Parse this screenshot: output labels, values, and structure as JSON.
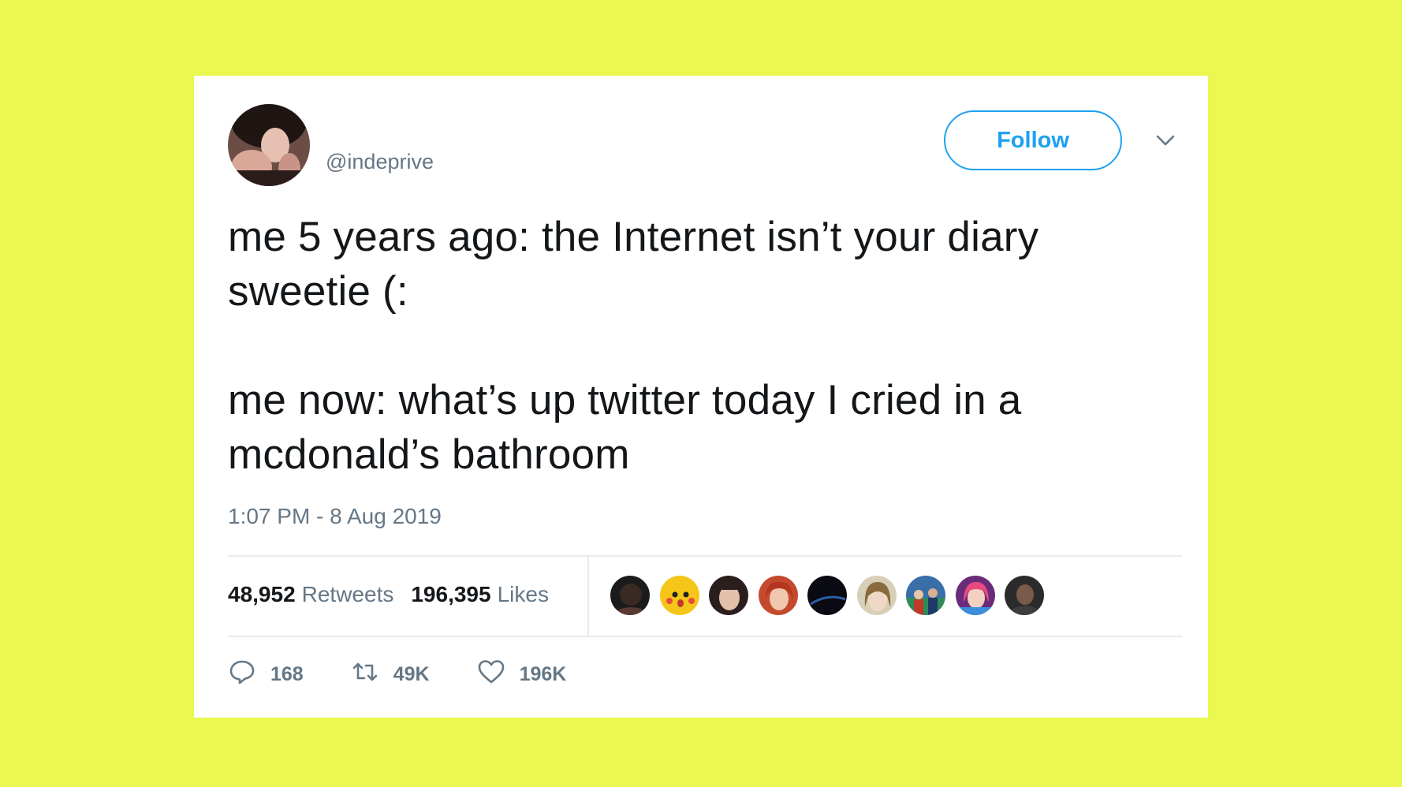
{
  "tweet": {
    "handle": "@indeprive",
    "follow_label": "Follow",
    "text_lines": [
      "me 5 years ago: the Internet isn’t your diary",
      "sweetie (:",
      "",
      "me now: what’s up twitter today I cried in a",
      "mcdonald’s bathroom"
    ],
    "timestamp": "1:07 PM - 8 Aug 2019"
  },
  "stats": {
    "retweets_count": "48,952",
    "retweets_label": "Retweets",
    "likes_count": "196,395",
    "likes_label": "Likes"
  },
  "actions": {
    "replies": "168",
    "retweets": "49K",
    "likes": "196K"
  },
  "colors": {
    "background": "#eaf84f",
    "accent": "#1da1f2",
    "text": "#14171a",
    "muted": "#657786"
  }
}
